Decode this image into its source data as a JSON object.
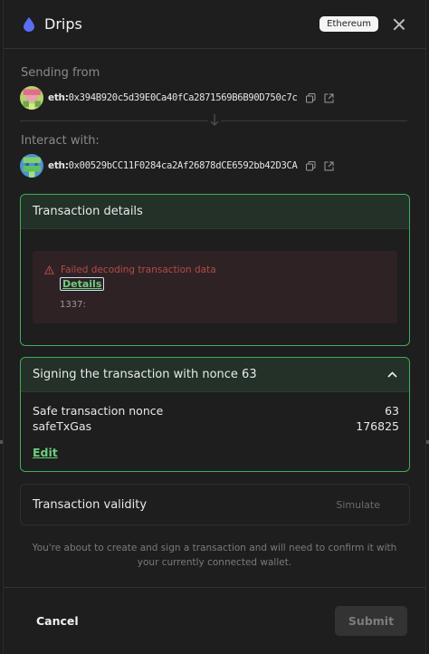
{
  "header": {
    "title": "Drips",
    "chain_badge": "Ethereum"
  },
  "sending_from": {
    "label": "Sending from",
    "prefix": "eth:",
    "address": "0x394B920c5d39E0Ca40fCa2871569B6B90D750c7c"
  },
  "interact_with": {
    "label": "Interact with:",
    "prefix": "eth:",
    "address": "0x00529bCC11F0284ca2Af26878dCE6592bb42D3CA"
  },
  "transaction_details": {
    "title": "Transaction details",
    "error_text": "Failed decoding transaction data",
    "details_link": "Details",
    "error_code": "1337:"
  },
  "signing": {
    "title": "Signing the transaction with nonce 63",
    "rows": [
      {
        "label": "Safe transaction nonce",
        "value": "63"
      },
      {
        "label": "safeTxGas",
        "value": "176825"
      }
    ],
    "edit_label": "Edit"
  },
  "validity": {
    "label": "Transaction validity",
    "simulate_label": "Simulate"
  },
  "note": "You're about to create and sign a transaction and will need to confirm it with your currently connected wallet.",
  "footer": {
    "cancel_label": "Cancel",
    "submit_label": "Submit"
  },
  "colors": {
    "accent_green": "#3fae5b",
    "link_green": "#6ad07f",
    "error_red": "#b24b4b",
    "drop_blue": "#5a6ef2"
  },
  "icons": [
    "drop-icon",
    "close-icon",
    "copy-icon",
    "external-link-icon",
    "arrow-down-icon",
    "warning-icon",
    "chevron-up-icon"
  ]
}
